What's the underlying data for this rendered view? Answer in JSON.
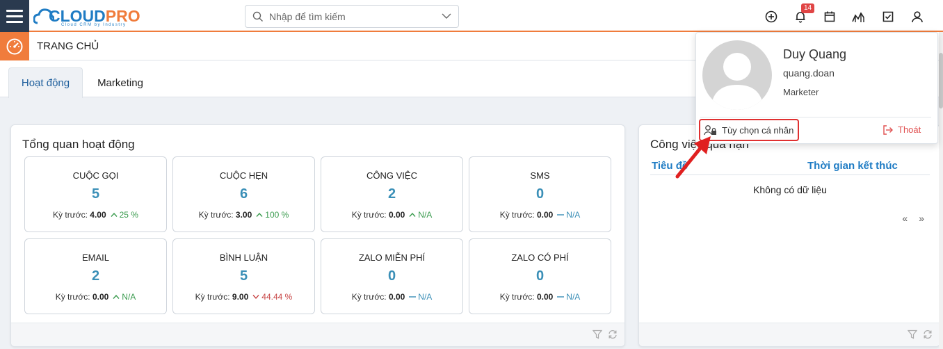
{
  "app": {
    "logo_primary": "CLOUD",
    "logo_accent": "PRO",
    "logo_tagline": "Cloud CRM by Industry"
  },
  "search": {
    "placeholder": "Nhập để tìm kiếm"
  },
  "topbar": {
    "notification_count": "14",
    "icons": [
      "plus-circle-icon",
      "bell-icon",
      "calendar-icon",
      "chart-icon",
      "checkbox-icon",
      "user-icon"
    ]
  },
  "breadcrumb": {
    "title": "TRANG CHỦ"
  },
  "tabs": [
    {
      "label": "Hoạt động",
      "active": true
    },
    {
      "label": "Marketing",
      "active": false
    }
  ],
  "overview": {
    "title": "Tổng quan hoạt động",
    "prev_label": "Kỳ trước:",
    "stats": [
      {
        "label": "CUỘC GỌI",
        "value": "5",
        "prev": "4.00",
        "change": "25 %",
        "trend": "up"
      },
      {
        "label": "CUỘC HẸN",
        "value": "6",
        "prev": "3.00",
        "change": "100 %",
        "trend": "up"
      },
      {
        "label": "CÔNG VIỆC",
        "value": "2",
        "prev": "0.00",
        "change": "N/A",
        "trend": "up"
      },
      {
        "label": "SMS",
        "value": "0",
        "prev": "0.00",
        "change": "N/A",
        "trend": "flat"
      },
      {
        "label": "EMAIL",
        "value": "2",
        "prev": "0.00",
        "change": "N/A",
        "trend": "up"
      },
      {
        "label": "BÌNH LUẬN",
        "value": "5",
        "prev": "9.00",
        "change": "44.44 %",
        "trend": "down"
      },
      {
        "label": "ZALO MIỄN PHÍ",
        "value": "0",
        "prev": "0.00",
        "change": "N/A",
        "trend": "flat"
      },
      {
        "label": "ZALO CÓ PHÍ",
        "value": "0",
        "prev": "0.00",
        "change": "N/A",
        "trend": "flat"
      }
    ]
  },
  "overdue": {
    "title": "Công việc quá hạn",
    "col_title": "Tiêu đề",
    "col_end": "Thời gian kết thúc",
    "empty": "Không có dữ liệu",
    "prev": "«",
    "next": "»"
  },
  "profile": {
    "name": "Duy Quang",
    "login": "quang.doan",
    "role": "Marketer",
    "preferences_label": "Tùy chọn cá nhân",
    "logout_label": "Thoát"
  },
  "colors": {
    "brand_blue": "#1f7cc4",
    "brand_orange": "#f07c3c",
    "value_blue": "#3a8fb7",
    "up_green": "#3a9b4e",
    "down_red": "#c84545",
    "highlight_red": "#e03030"
  }
}
